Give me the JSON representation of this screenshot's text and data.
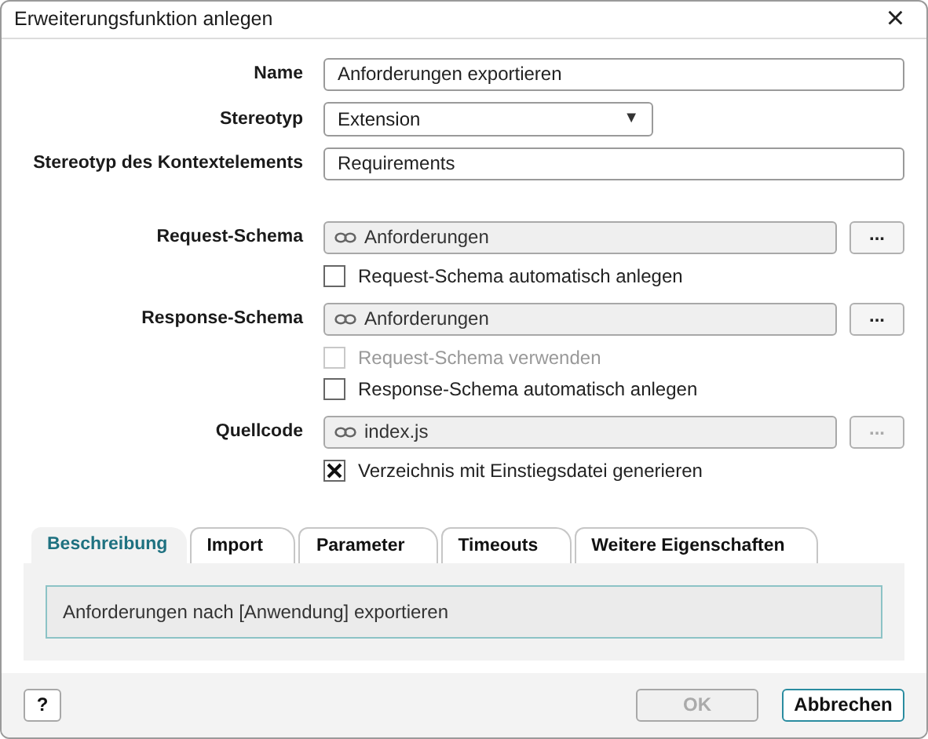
{
  "window": {
    "title": "Erweiterungsfunktion anlegen",
    "close": "×"
  },
  "basics": [
    {
      "kind": "text",
      "label": "Name",
      "value": "Anforderungen exportieren"
    },
    {
      "kind": "select",
      "label": "Stereotyp",
      "value": "Extension",
      "caret": "▼"
    },
    {
      "kind": "text",
      "label": "Stereotyp des Kontextelements",
      "value": "Requirements"
    }
  ],
  "schemas": [
    {
      "label": "Request-Schema",
      "value": "Anforderungen",
      "browse": "...",
      "browse_disabled": false,
      "options": [
        {
          "label": "Request-Schema automatisch anlegen",
          "checked": false,
          "disabled": false
        }
      ]
    },
    {
      "label": "Response-Schema",
      "value": "Anforderungen",
      "browse": "...",
      "browse_disabled": false,
      "options": [
        {
          "label": "Request-Schema verwenden",
          "checked": false,
          "disabled": true
        },
        {
          "label": "Response-Schema automatisch anlegen",
          "checked": false,
          "disabled": false
        }
      ]
    },
    {
      "label": "Quellcode",
      "value": "index.js",
      "browse": "...",
      "browse_disabled": true,
      "options": [
        {
          "label": "Verzeichnis mit Einstiegsdatei generieren",
          "checked": true,
          "disabled": false
        }
      ]
    }
  ],
  "tabs": [
    {
      "label": "Beschreibung",
      "selected": true
    },
    {
      "label": "Import",
      "selected": false
    },
    {
      "label": "Parameter",
      "selected": false
    },
    {
      "label": "Timeouts",
      "selected": false
    },
    {
      "label": "Weitere Eigenschaften",
      "selected": false
    }
  ],
  "description": "Anforderungen nach [Anwendung] exportieren",
  "footer": {
    "help": "?",
    "buttons": [
      {
        "label": "OK",
        "disabled": true,
        "default": false
      },
      {
        "label": "Abbrechen",
        "disabled": false,
        "default": true
      }
    ]
  }
}
